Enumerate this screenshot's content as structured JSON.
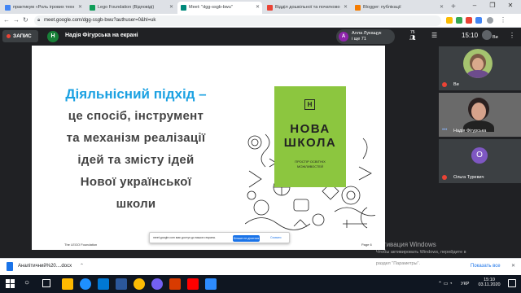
{
  "browser": {
    "tabs": [
      {
        "title": "практикум «Роль ігрових техн",
        "favicon_color": "#4285f4"
      },
      {
        "title": "Lego Foundation (Відповіді)",
        "favicon_color": "#0f9d58"
      },
      {
        "title": "Meet: \"dgg-ssgb-bwu\"",
        "favicon_color": "#00897b"
      },
      {
        "title": "Відділ дошкільної та початково",
        "favicon_color": "#ea4335"
      },
      {
        "title": "Blogger: публікації",
        "favicon_color": "#f57c00"
      }
    ],
    "new_tab": "+",
    "url": "meet.google.com/dgg-ssgb-bwu?authuser=0&hl=uk"
  },
  "meet_header": {
    "record_label": "ЗАПИС",
    "presenter_initial": "Н",
    "presenter_text": "Надія Фігурська на екрані",
    "viewer_initial": "А",
    "viewer_name": "Алла Лукащук",
    "viewer_more": "і ще 71",
    "participants_count": "75",
    "time": "15:10",
    "self_label": "Ви"
  },
  "slide": {
    "heading_highlight": "Діяльнісний підхід –",
    "lines": [
      "це спосіб, інструмент",
      "та механізм реалізації",
      "ідей та змісту ідей",
      "Нової української",
      "школи"
    ],
    "book_logo": "Н",
    "book_title_line1": "НОВА",
    "book_title_line2": "ШКОЛА",
    "book_subtitle_line1": "ПРОСТІР ОСВІТНІХ",
    "book_subtitle_line2": "МОЖЛИВОСТЕЙ",
    "footer_left": "The LEGO Foundation",
    "footer_right": "Page 6",
    "colors": {
      "highlight": "#1ba1e2",
      "book_green": "#8cc63f"
    }
  },
  "share_bar": {
    "text": "meet.google.com має доступ до вашого екрана.",
    "stop_label": "Більше не ділитися",
    "hide_label": "Сховати"
  },
  "participants": [
    {
      "name": "Ви",
      "type": "video"
    },
    {
      "name": "Надія Фігурська",
      "type": "video"
    },
    {
      "name": "Ольга Туревич",
      "type": "avatar",
      "initial": "О",
      "color": "#7e57c2"
    }
  ],
  "download": {
    "filename": "Аналітичний%20....docx",
    "show_all": "Показать все"
  },
  "activation": {
    "title": "Активация Windows",
    "line1": "Чтобы активировать Windows, перейдите в",
    "line2": "раздел \"Параметры\"."
  },
  "taskbar": {
    "lang": "УКР",
    "time": "15:10",
    "date": "03.11.2020"
  }
}
